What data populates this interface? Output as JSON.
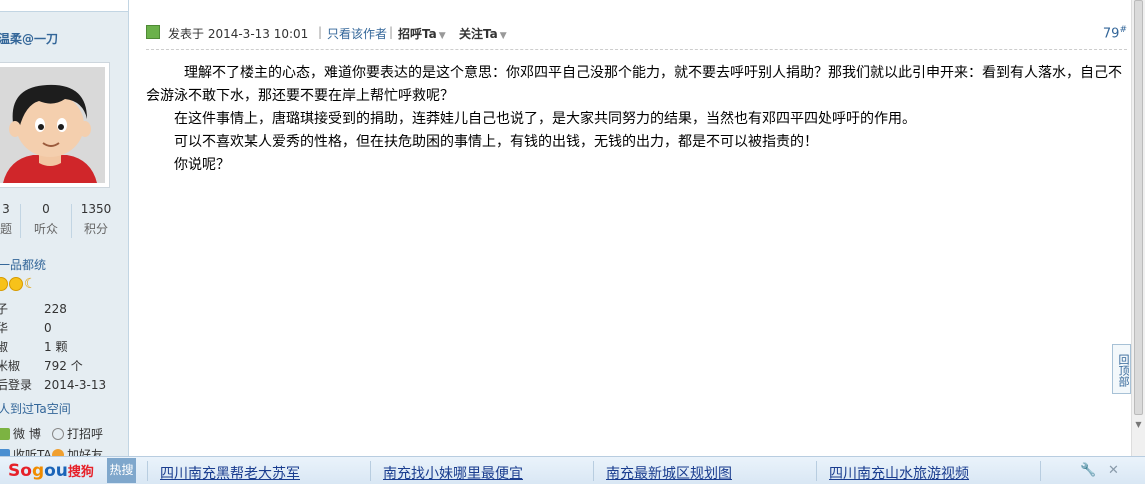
{
  "sidebar": {
    "username": "温柔@一刀",
    "stats": [
      {
        "value": "3",
        "label": "题"
      },
      {
        "value": "0",
        "label": "听众"
      },
      {
        "value": "1350",
        "label": "积分"
      }
    ],
    "group": "一品都统",
    "info": [
      {
        "key": "子",
        "value": "228"
      },
      {
        "key": "华",
        "value": "0"
      },
      {
        "key": "椒",
        "value": "1 颗"
      },
      {
        "key": "米椒",
        "value": "792 个"
      },
      {
        "key": "后登录",
        "value": "2014-3-13"
      }
    ],
    "visit_link": "人到过Ta空间",
    "actions": {
      "weibo": "微 博",
      "greet": "打招呼",
      "listen": "收听TA",
      "add_friend": "加好友"
    }
  },
  "post": {
    "posted_at": "发表于 2014-3-13 10:01",
    "separator": "|",
    "only_author": "只看该作者",
    "greet": "招呼Ta",
    "follow": "关注Ta",
    "floor": "79",
    "floor_mark": "#",
    "paragraphs": [
      "理解不了楼主的心态，难道你要表达的是这个意思：你邓四平自己没那个能力，就不要去呼吁别人捐助？那我们就以此引申开来：看到有人落水，自己不会游泳不敢下水，那还要不要在岸上帮忙呼救呢？",
      "在这件事情上，唐璐琪接受到的捐助，连莽娃儿自己也说了，是大家共同努力的结果，当然也有邓四平四处呼吁的作用。",
      "可以不喜欢某人爱秀的性格，但在扶危助困的事情上，有钱的出钱，无钱的出力，都是不可以被指责的！",
      "你说呢？"
    ]
  },
  "back_to_top": "回顶部",
  "sogou": {
    "logo_parts": [
      "So",
      "g",
      "ou",
      "搜狗"
    ],
    "hot_label": "热搜",
    "hot_links": [
      "四川南充黑帮老大苏军",
      "南充找小妹哪里最便宜",
      "南充最新城区规划图",
      "四川南充山水旅游视频"
    ],
    "tools": [
      "🔧",
      "✕"
    ]
  }
}
